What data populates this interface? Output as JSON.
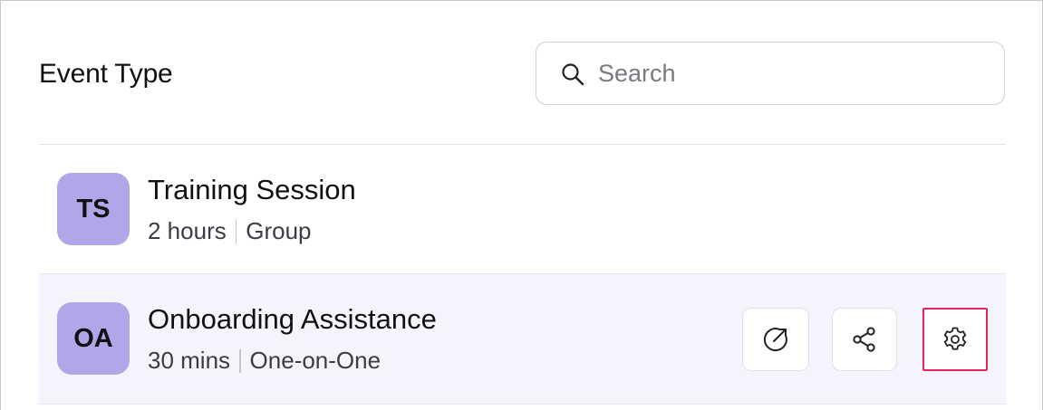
{
  "header": {
    "title": "Event Type",
    "search": {
      "placeholder": "Search",
      "value": "",
      "icon": "search-icon"
    }
  },
  "events": [
    {
      "initials": "TS",
      "name": "Training Session",
      "duration": "2 hours",
      "type": "Group",
      "avatar_color": "#b3a6e8"
    },
    {
      "initials": "OA",
      "name": "Onboarding Assistance",
      "duration": "30 mins",
      "type": "One-on-One",
      "avatar_color": "#b3a6e8",
      "actions": [
        {
          "icon": "open-external-icon"
        },
        {
          "icon": "share-icon"
        },
        {
          "icon": "gear-icon"
        }
      ]
    }
  ],
  "colors": {
    "accent_highlight": "#e2245f",
    "hover_row_bg": "#f5f4fc",
    "avatar_bg": "#b3a6e8"
  }
}
